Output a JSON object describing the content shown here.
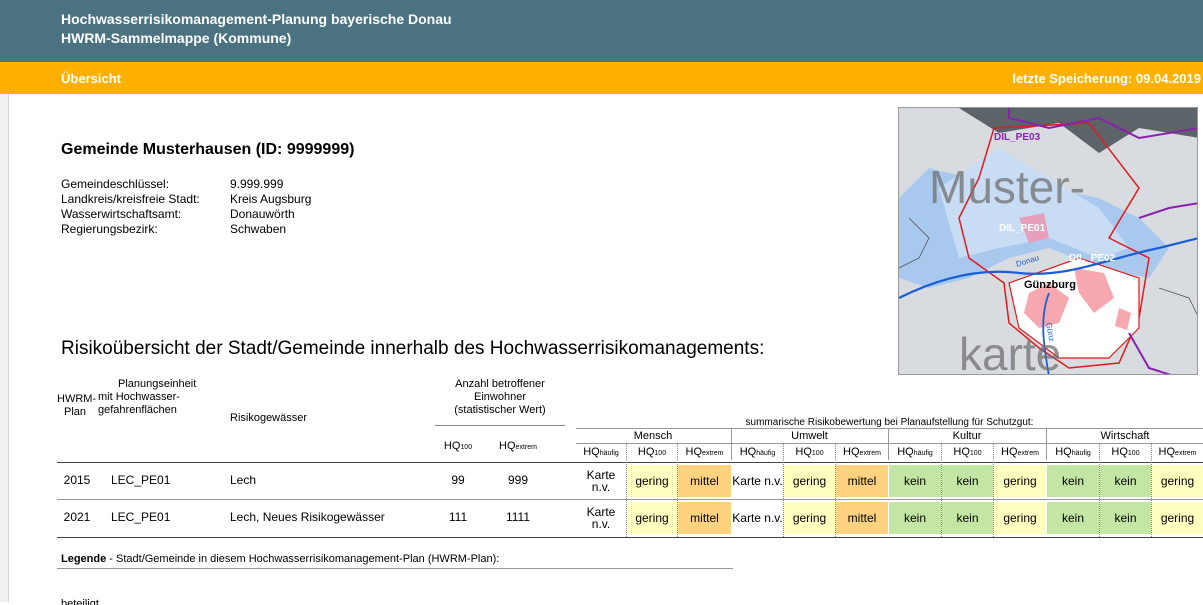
{
  "header": {
    "title_line1": "Hochwasserrisikomanagement-Planung bayerische Donau",
    "title_line2": "HWRM-Sammelmappe (Kommune)"
  },
  "section": {
    "title": "Übersicht",
    "save_status": "letzte Speicherung: 09.04.2019"
  },
  "municipality": {
    "title": "Gemeinde Musterhausen (ID: 9999999)",
    "info": [
      {
        "label": "Gemeindeschlüssel:",
        "value": "9.999.999"
      },
      {
        "label": "Landkreis/kreisfreie Stadt:",
        "value": "Kreis Augsburg"
      },
      {
        "label": "Wasserwirtschaftsamt:",
        "value": "Donauwörth"
      },
      {
        "label": "Regierungsbezirk:",
        "value": "Schwaben"
      }
    ]
  },
  "map": {
    "watermark_top": "Muster-",
    "watermark_bottom": "karte",
    "labels": [
      "DIL_PE03",
      "DIL_PE01",
      "DIL_PE02",
      "Günzburg",
      "Donau",
      "Günz"
    ]
  },
  "risk": {
    "heading": "Risikoübersicht der Stadt/Gemeinde innerhalb des Hochwasserrisikomanagements:",
    "col_plan_1": "HWRM-",
    "col_plan_2": "Plan",
    "col_unit_1": "Planungseinheit",
    "col_unit_2": "mit Hochwasser-",
    "col_unit_3": "gefahrenflächen",
    "col_water": "Risikogewässer",
    "col_count_1": "Anzahl betroffener",
    "col_count_2": "Einwohner",
    "col_count_3": "(statistischer Wert)",
    "col_hq100": "HQ",
    "col_hq100_sub": "100",
    "col_hqextrem": "HQ",
    "col_hqextrem_sub": "extrem",
    "summary_header": "summarische Risikobewertung bei Planaufstellung für Schutzgut:",
    "groups": [
      "Mensch",
      "Umwelt",
      "Kultur",
      "Wirtschaft"
    ],
    "sub_base": "HQ",
    "subs": [
      "häufig",
      "100",
      "extrem"
    ],
    "rows": [
      {
        "year": "2015",
        "unit": "LEC_PE01",
        "water": "Lech",
        "hq100": "99",
        "hqextrem": "999",
        "ratings": [
          "Karte n.v.",
          "gering",
          "mittel",
          "Karte n.v.",
          "gering",
          "mittel",
          "kein",
          "kein",
          "gering",
          "kein",
          "kein",
          "gering"
        ]
      },
      {
        "year": "2021",
        "unit": "LEC_PE01",
        "water": "Lech, Neues Risikogewässer",
        "hq100": "111",
        "hqextrem": "1111",
        "ratings": [
          "Karte n.v.",
          "gering",
          "mittel",
          "Karte n.v.",
          "gering",
          "mittel",
          "kein",
          "kein",
          "gering",
          "kein",
          "kein",
          "gering"
        ]
      }
    ]
  },
  "legend": {
    "bold": "Legende",
    "text": " - Stadt/Gemeinde in diesem Hochwasserrisikomanagement-Plan (HWRM-Plan):",
    "line2": "beteiligt"
  },
  "colors": {
    "header": "#4a7280",
    "section": "#ffb000",
    "rating_yellow": "#ffffc0",
    "rating_orange": "#ffd280",
    "rating_green": "#c4e6a4"
  }
}
